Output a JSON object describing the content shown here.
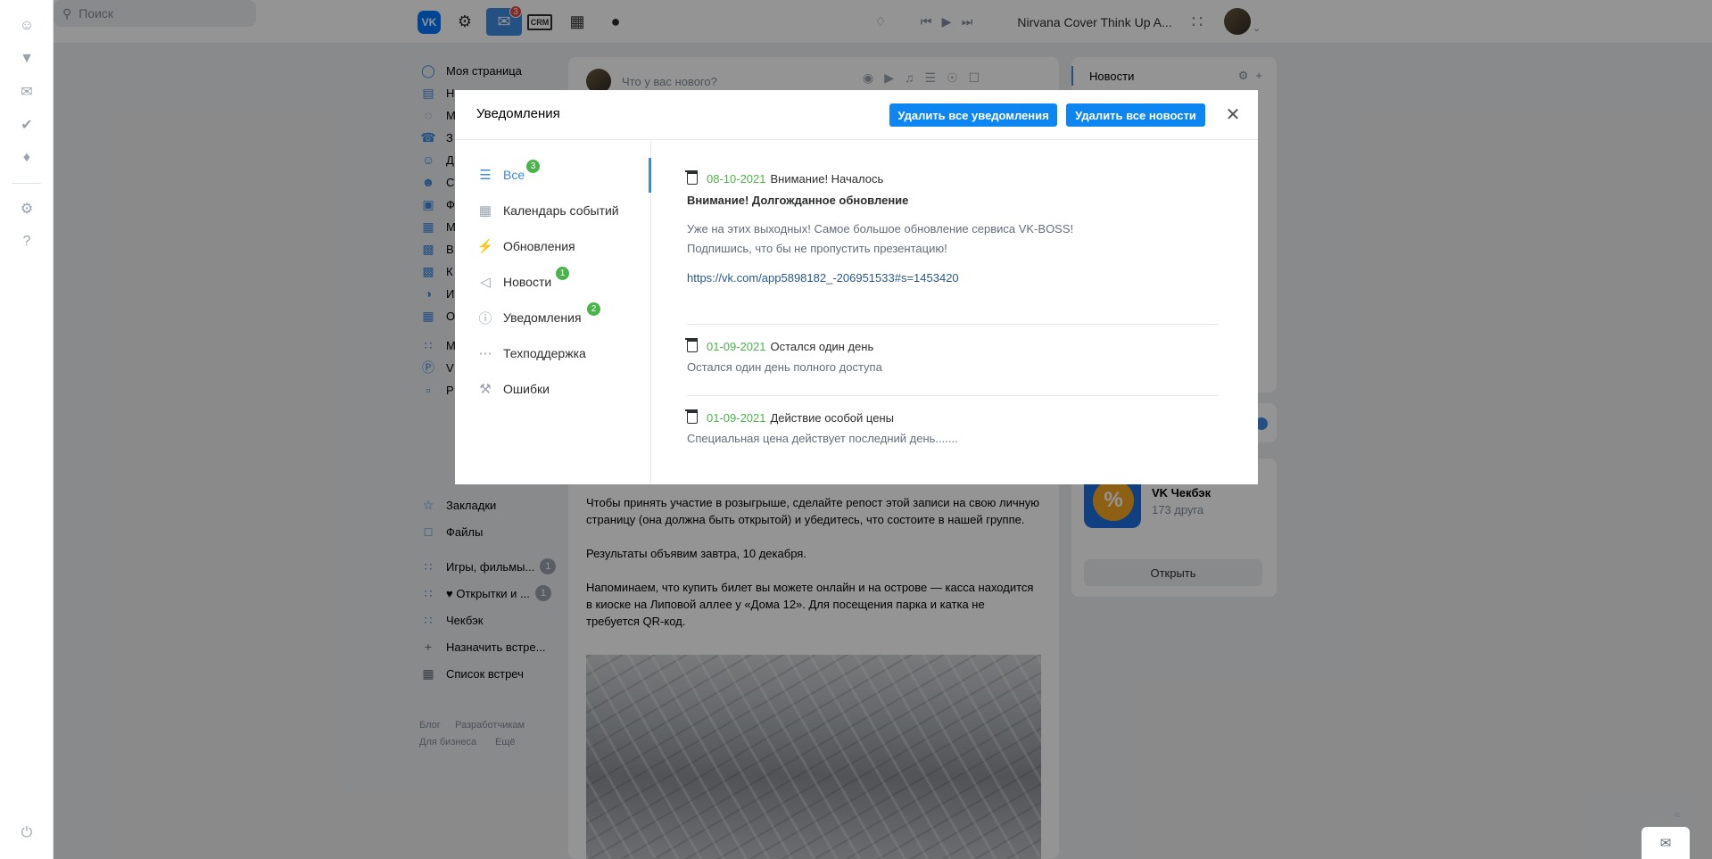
{
  "sidebar_ext": {
    "icons": [
      "people-icon",
      "filter-icon",
      "mail-icon",
      "check-circle-icon",
      "bell-icon",
      "gear-icon",
      "help-icon",
      "power-icon"
    ]
  },
  "header": {
    "logo": "VK",
    "mail_badge": "3",
    "crm_label": "CRM",
    "search_placeholder": "Поиск",
    "track": "Nirvana Cover Think Up A..."
  },
  "left_nav": {
    "items": [
      {
        "label": "Моя страница"
      },
      {
        "label": "Н"
      },
      {
        "label": "М"
      },
      {
        "label": "З"
      },
      {
        "label": "Д"
      },
      {
        "label": "С"
      },
      {
        "label": "Ф"
      },
      {
        "label": "М"
      },
      {
        "label": "В"
      },
      {
        "label": "К"
      },
      {
        "label": "И"
      },
      {
        "label": "О"
      },
      {
        "label": "М"
      },
      {
        "label": "V"
      },
      {
        "label": "Р"
      }
    ],
    "lower": [
      {
        "label": "Закладки"
      },
      {
        "label": "Файлы"
      },
      {
        "label": "Игры, фильмы...",
        "count": "1"
      },
      {
        "label": "♥ Открытки и ...",
        "count": "1"
      },
      {
        "label": "Чекбэк"
      },
      {
        "label": "Назначить встре..."
      },
      {
        "label": "Список встреч"
      }
    ],
    "footer": [
      "Блог",
      "Разработчикам",
      "Для бизнеса",
      "Ещё"
    ]
  },
  "feed": {
    "composer_placeholder": "Что у вас нового?",
    "post_paragraphs": [
      "Чтобы принять участие в розыгрыше, сделайте репост этой записи на свою личную страницу (она должна быть открытой) и убедитесь, что состоите в нашей группе.",
      "Результаты объявим завтра, 10 декабря.",
      "Напоминаем, что купить билет вы можете онлайн и на острове — касса находится в киоске на Липовой аллее у «Дома 12». Для посещения парка и катка не требуется QR-код."
    ]
  },
  "right_col": {
    "news_tab": "Новости",
    "app_name": "VK Чекбэк",
    "app_friends": "173 друга",
    "app_open": "Открыть"
  },
  "modal": {
    "title": "Уведомления",
    "btn_delete_notifications": "Удалить все уведомления",
    "btn_delete_news": "Удалить все новости",
    "categories": [
      {
        "label": "Все",
        "badge": "3",
        "icon": "list-icon",
        "active": true
      },
      {
        "label": "Календарь событий",
        "badge": "",
        "icon": "calendar-icon"
      },
      {
        "label": "Обновления",
        "badge": "",
        "icon": "lightning-icon"
      },
      {
        "label": "Новости",
        "badge": "1",
        "icon": "megaphone-icon"
      },
      {
        "label": "Уведомления",
        "badge": "2",
        "icon": "exclamation-circle-icon"
      },
      {
        "label": "Техподдержка",
        "badge": "",
        "icon": "chat-dots-icon"
      },
      {
        "label": "Ошибки",
        "badge": "",
        "icon": "wrench-icon"
      }
    ],
    "notifications": [
      {
        "date": "08-10-2021",
        "title": "Внимание! Началось",
        "subtitle": "Внимание! Долгожданное обновление",
        "body1": "Уже на этих выходных! Самое большое обновление сервиса VK-BOSS!",
        "body2": "Подпишись, что бы не пропустить презентацию!",
        "link": "https://vk.com/app5898182_-206951533#s=1453420"
      },
      {
        "date": "01-09-2021",
        "title": "Остался один день",
        "body1": "Остался один день полного доступа"
      },
      {
        "date": "01-09-2021",
        "title": "Действие особой цены",
        "body1": "Специальная цена действует последний день......."
      }
    ]
  }
}
